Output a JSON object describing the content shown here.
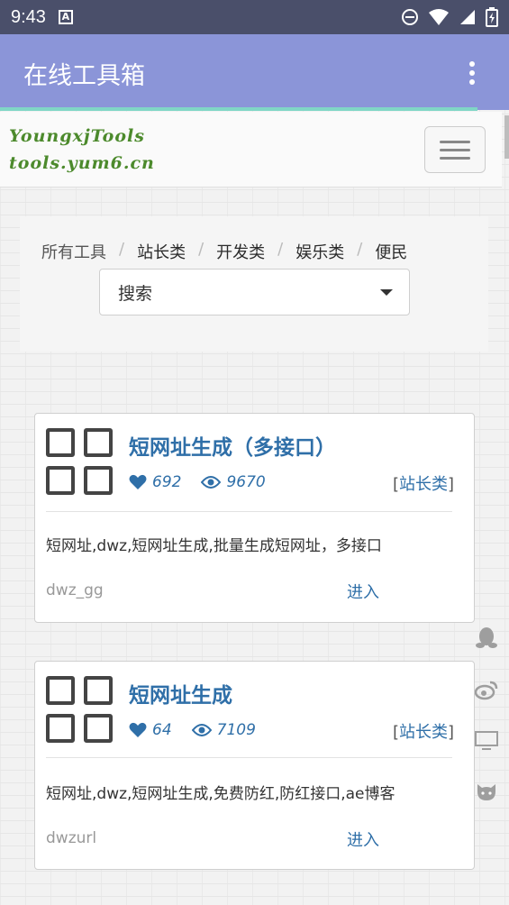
{
  "status_bar": {
    "time": "9:43",
    "icons": [
      "notification-a-icon",
      "dnd-icon",
      "wifi-icon",
      "signal-icon",
      "battery-icon"
    ]
  },
  "app_bar": {
    "title": "在线工具箱",
    "menu_icon": "more-vert-icon"
  },
  "header": {
    "logo_line1": "YoungxjTools",
    "logo_line2": "tools.yum6.cn",
    "menu_icon": "hamburger-icon"
  },
  "nav": {
    "breadcrumb": [
      "所有工具",
      "站长类",
      "开发类",
      "娱乐类",
      "便民"
    ],
    "separator": "/",
    "select_value": "搜索"
  },
  "cards": [
    {
      "title": "短网址生成（多接口）",
      "likes": "692",
      "views": "9670",
      "category": "站长类",
      "description": "短网址,dwz,短网址生成,批量生成短网址，多接口",
      "slug": "dwz_gg",
      "enter_label": "进入"
    },
    {
      "title": "短网址生成",
      "likes": "64",
      "views": "7109",
      "category": "站长类",
      "description": "短网址,dwz,短网址生成,免费防红,防红接口,ae博客",
      "slug": "dwzurl",
      "enter_label": "进入"
    }
  ],
  "side_icons": [
    "qq-icon",
    "weibo-icon",
    "desktop-icon",
    "github-icon"
  ],
  "colors": {
    "status_bar": "#4a4f6a",
    "app_bar": "#8b95d8",
    "accent_line": "#7fd6c6",
    "link_blue": "#2f6fa8",
    "logo_green": "#4c8a2c"
  }
}
